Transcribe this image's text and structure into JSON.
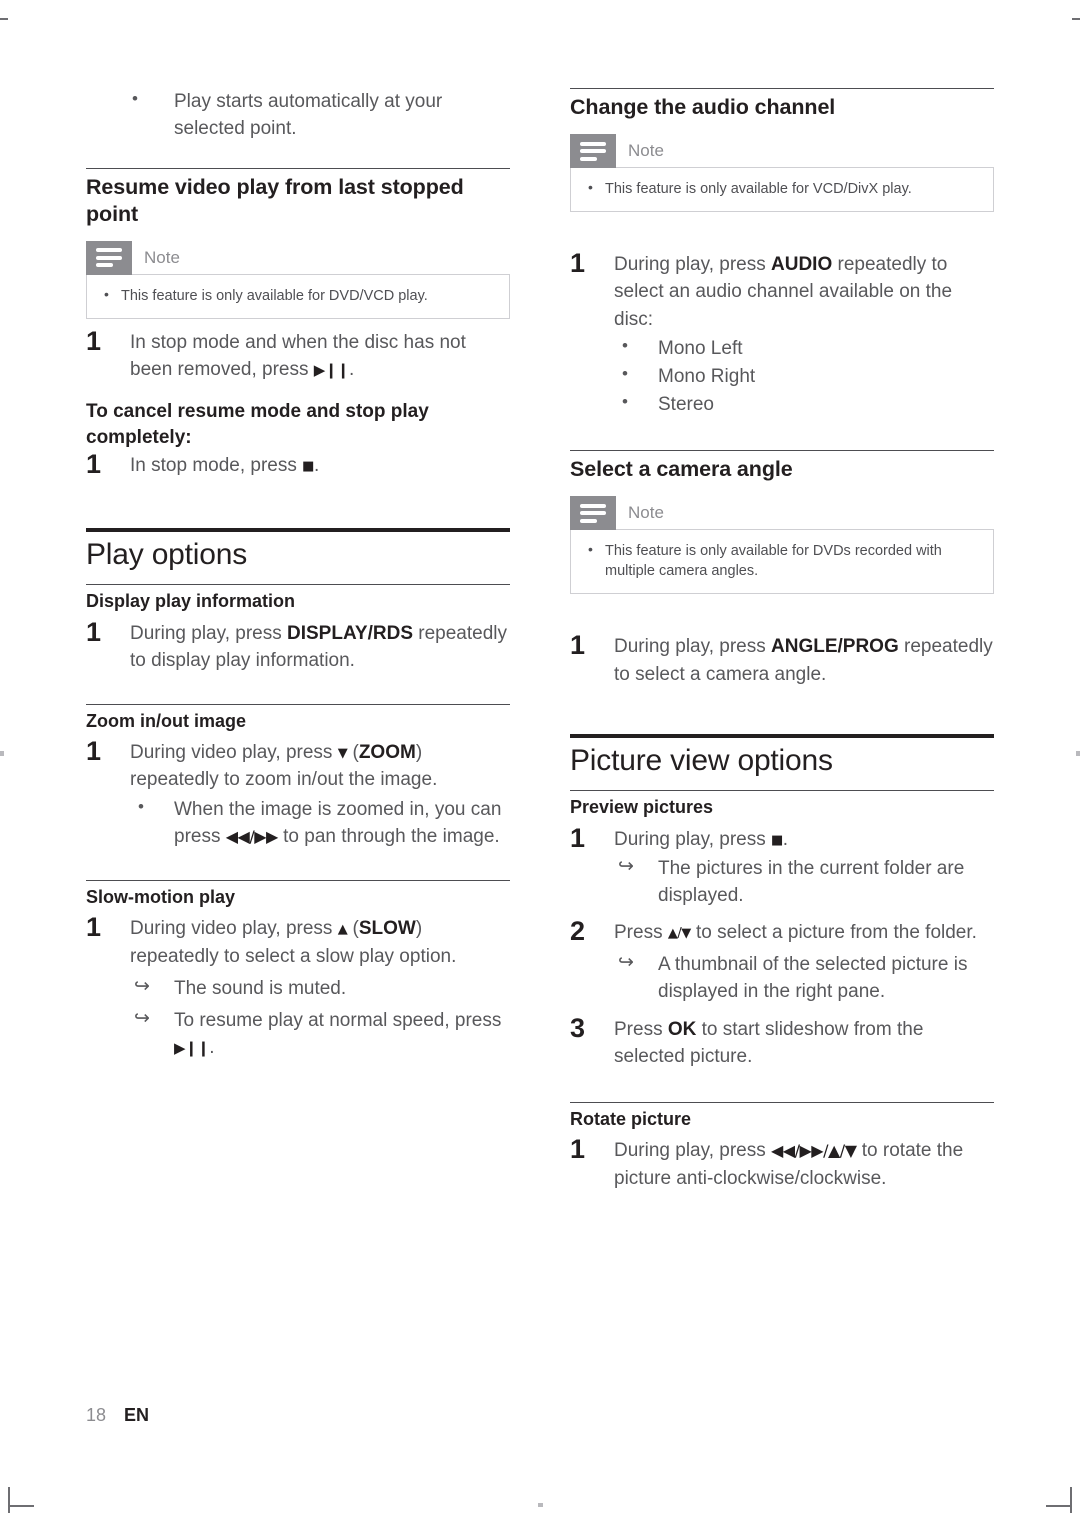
{
  "document": {
    "footer": {
      "page_number": "18",
      "language": "EN"
    }
  },
  "glyphs": {
    "play_pause": "▶❙❙",
    "stop": "■",
    "down": "▼",
    "up": "▲",
    "rewind": "◀◀",
    "forward": "▶▶",
    "rew_fwd": "◀◀/▶▶",
    "up_down": "▲/▼",
    "rew_fwd_up_down": "◀◀/▶▶/▲/▼",
    "note_icon": "note-lines-icon"
  },
  "left_column": {
    "intro_bullet": "Play starts automatically at your selected point.",
    "resume_section": {
      "heading": "Resume video play from last stopped point",
      "note": {
        "title": "Note",
        "items": [
          "This feature is only available for DVD/VCD play."
        ]
      },
      "step1_a": "In stop mode and when the disc has not been removed, press",
      "step1_b": ".",
      "cancel_heading": "To cancel resume mode and stop play completely:",
      "cancel_step_a": "In stop mode, press",
      "cancel_step_b": ".",
      "step_numbers": {
        "one": "1"
      }
    },
    "play_options": {
      "heading": "Play options",
      "display_info": {
        "heading": "Display play information",
        "num": "1",
        "text_a": "During play, press",
        "key": "DISPLAY/RDS",
        "text_b": "repeatedly to display play information."
      },
      "zoom_image": {
        "heading": "Zoom in/out image",
        "num": "1",
        "text_a": "During video play, press",
        "key": "ZOOM",
        "text_b": "repeatedly to zoom in/out the image.",
        "bullet_a": "When the image is zoomed in, you can press",
        "bullet_b": "to pan through the image."
      },
      "slow_motion": {
        "heading": "Slow-motion play",
        "num": "1",
        "text_a": "During video play, press",
        "key": "SLOW",
        "text_b": "repeatedly to select a slow play option.",
        "arrow1": "The sound is muted.",
        "arrow2_a": "To resume play at normal speed, press",
        "arrow2_b": "."
      }
    }
  },
  "right_column": {
    "audio_channel": {
      "heading": "Change the audio channel",
      "note": {
        "title": "Note",
        "items": [
          "This feature is only available for VCD/DivX play."
        ]
      },
      "num": "1",
      "text_a": "During play, press",
      "key": "AUDIO",
      "text_b": "repeatedly to select an audio channel available on the disc:",
      "options": [
        "Mono Left",
        "Mono Right",
        "Stereo"
      ]
    },
    "camera_angle": {
      "heading": "Select a camera angle",
      "note": {
        "title": "Note",
        "items": [
          "This feature is only available for DVDs recorded with multiple camera angles."
        ]
      },
      "num": "1",
      "text_a": "During play, press",
      "key": "ANGLE/PROG",
      "text_b": "repeatedly to select a camera angle."
    },
    "picture_view_options": {
      "heading": "Picture view options",
      "preview_pictures": {
        "heading": "Preview pictures",
        "step1": {
          "num": "1",
          "text_a": "During play, press",
          "text_b": ".",
          "arrow": "The pictures in the current folder are displayed."
        },
        "step2": {
          "num": "2",
          "text_a": "Press",
          "text_b": "to select a picture from the folder.",
          "arrow": "A thumbnail of the selected picture is displayed in the right pane."
        },
        "step3": {
          "num": "3",
          "text_a": "Press",
          "key": "OK",
          "text_b": "to start slideshow from the selected picture."
        }
      },
      "rotate_picture": {
        "heading": "Rotate picture",
        "num": "1",
        "text_a": "During play, press",
        "text_b": "to rotate the picture anti-clockwise/clockwise."
      }
    }
  }
}
